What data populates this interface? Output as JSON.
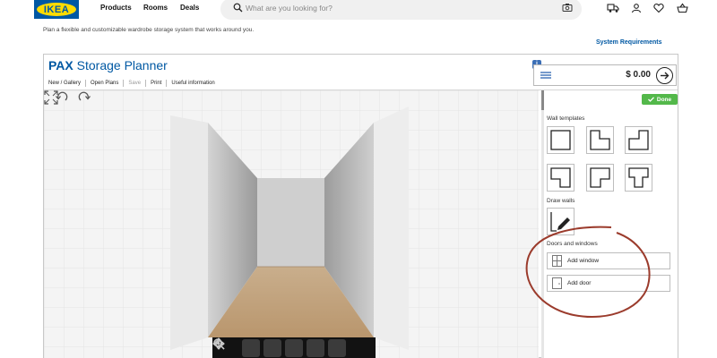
{
  "brand": {
    "logo_text": "IKEA",
    "primary_color": "#0058a3",
    "logo_yellow": "#ffdb00"
  },
  "nav": {
    "links": [
      "Products",
      "Rooms",
      "Deals"
    ]
  },
  "search": {
    "placeholder": "What are you looking for?"
  },
  "header_icons": [
    "truck-icon",
    "user-icon",
    "heart-icon",
    "cart-icon"
  ],
  "intro_text": "Plan a flexible and customizable wardrobe storage system that works around you.",
  "system_requirements": "System  Requirements",
  "planner": {
    "title_bold": "PAX",
    "title_rest": " Storage Planner",
    "toolbar": [
      "New / Gallery",
      "Open Plans",
      "Save",
      "Print",
      "Useful information"
    ],
    "price": "$ 0.00",
    "info_badge": "i",
    "done_label": "Done",
    "done_color": "#53b84a",
    "sections": {
      "wall_templates": "Wall templates",
      "draw_walls": "Draw walls",
      "doors_windows": "Doors and windows"
    },
    "add_window": "Add window",
    "add_door": "Add door"
  },
  "viewport_tools": [
    "rotate-icon",
    "zoom-out-icon",
    "zoom-in-icon",
    "pan-icon",
    "center-icon"
  ],
  "annotation_color": "#9b3b2c"
}
